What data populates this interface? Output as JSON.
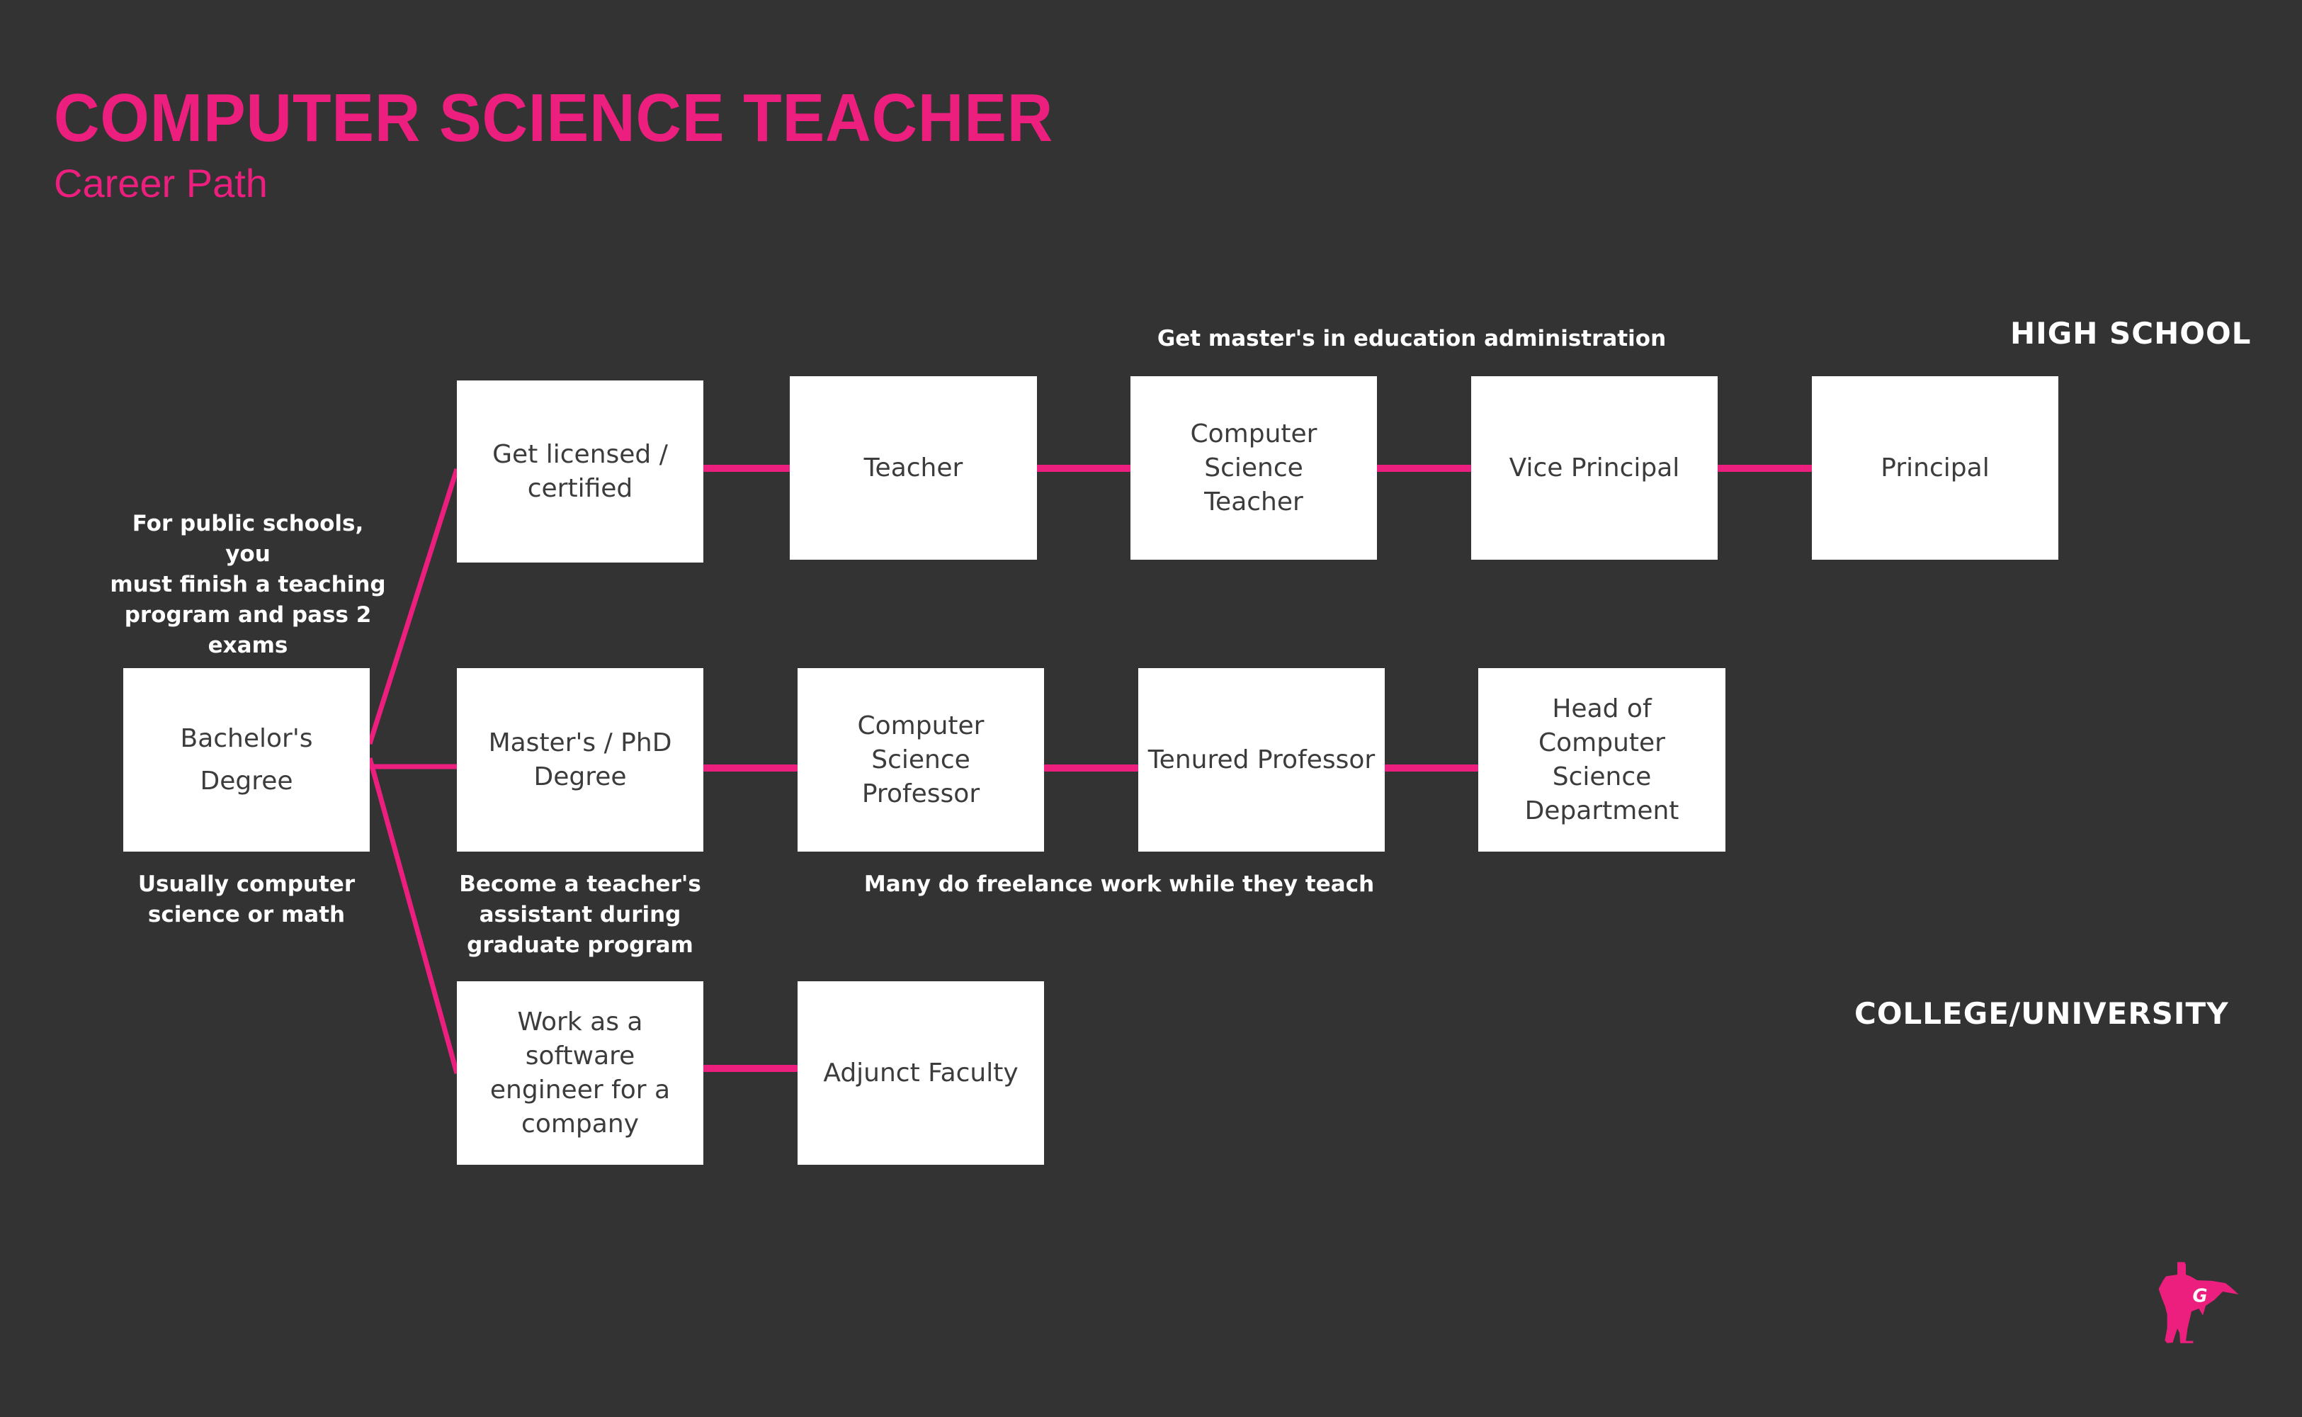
{
  "header": {
    "title": "COMPUTER SCIENCE TEACHER",
    "subtitle": "Career Path"
  },
  "colors": {
    "accent": "#ec1f7f",
    "background": "#333333",
    "box": "#ffffff",
    "box_text": "#3c3c3c",
    "note_text": "#ffffff"
  },
  "sections": {
    "high_school": "HIGH SCHOOL",
    "college": "COLLEGE/UNIVERSITY"
  },
  "nodes": {
    "bachelors": [
      "Bachelor's",
      "Degree"
    ],
    "licensed": [
      "Get licensed /",
      "certified"
    ],
    "teacher": [
      "Teacher"
    ],
    "cs_teacher": [
      "Computer Science",
      "Teacher"
    ],
    "vice_principal": [
      "Vice Principal"
    ],
    "principal": [
      "Principal"
    ],
    "masters": [
      "Master's / PhD",
      "Degree"
    ],
    "cs_professor": [
      "Computer Science",
      "Professor"
    ],
    "tenured": [
      "Tenured Professor"
    ],
    "head": [
      "Head of Computer",
      "Science",
      "Department"
    ],
    "software": [
      "Work as a software",
      "engineer for a",
      "company"
    ],
    "adjunct": [
      "Adjunct Faculty"
    ]
  },
  "notes": {
    "public_schools": [
      "For public schools, you",
      "must finish a teaching",
      "program and pass 2",
      "exams"
    ],
    "bachelors_major": [
      "Usually computer",
      "science or math"
    ],
    "teachers_assistant": [
      "Become a teacher's",
      "assistant during",
      "graduate program"
    ],
    "freelance": [
      "Many do freelance work while they teach"
    ],
    "admin_masters": [
      "Get master's in education administration"
    ]
  },
  "edges": [
    [
      "bachelors",
      "licensed"
    ],
    [
      "bachelors",
      "masters"
    ],
    [
      "bachelors",
      "software"
    ],
    [
      "licensed",
      "teacher"
    ],
    [
      "teacher",
      "cs_teacher"
    ],
    [
      "cs_teacher",
      "vice_principal"
    ],
    [
      "vice_principal",
      "principal"
    ],
    [
      "masters",
      "cs_professor"
    ],
    [
      "cs_professor",
      "tenured"
    ],
    [
      "tenured",
      "head"
    ],
    [
      "software",
      "adjunct"
    ]
  ],
  "logo": {
    "icon": "superhero-g-icon",
    "letter": "G"
  }
}
